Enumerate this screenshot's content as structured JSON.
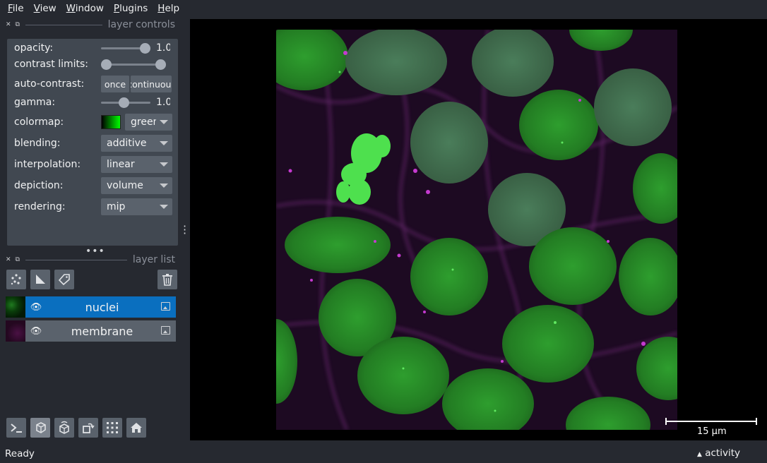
{
  "menu": [
    "File",
    "View",
    "Window",
    "Plugins",
    "Help"
  ],
  "layer_controls": {
    "title": "layer controls",
    "opacity": {
      "label": "opacity:",
      "value": "1.0",
      "level": 1.0
    },
    "contrast_limits": {
      "label": "contrast limits:"
    },
    "auto_contrast": {
      "label": "auto-contrast:",
      "once": "once",
      "continuous": "continuous"
    },
    "gamma": {
      "label": "gamma:",
      "value": "1.0",
      "level": 0.5
    },
    "colormap": {
      "label": "colormap:",
      "value": "green"
    },
    "blending": {
      "label": "blending:",
      "value": "additive"
    },
    "interpolation": {
      "label": "interpolation:",
      "value": "linear"
    },
    "depiction": {
      "label": "depiction:",
      "value": "volume"
    },
    "rendering": {
      "label": "rendering:",
      "value": "mip"
    }
  },
  "layer_list": {
    "title": "layer list",
    "layers": [
      {
        "name": "nuclei",
        "selected": true,
        "visible": true
      },
      {
        "name": "membrane",
        "selected": false,
        "visible": true
      }
    ]
  },
  "canvas": {
    "scale_bar_label": "15 µm"
  },
  "status": {
    "text": "Ready",
    "activity": "activity"
  },
  "colors": {
    "background": "#262930",
    "panel": "#414851",
    "selected": "#0a6fbf",
    "button": "#5a626c"
  }
}
